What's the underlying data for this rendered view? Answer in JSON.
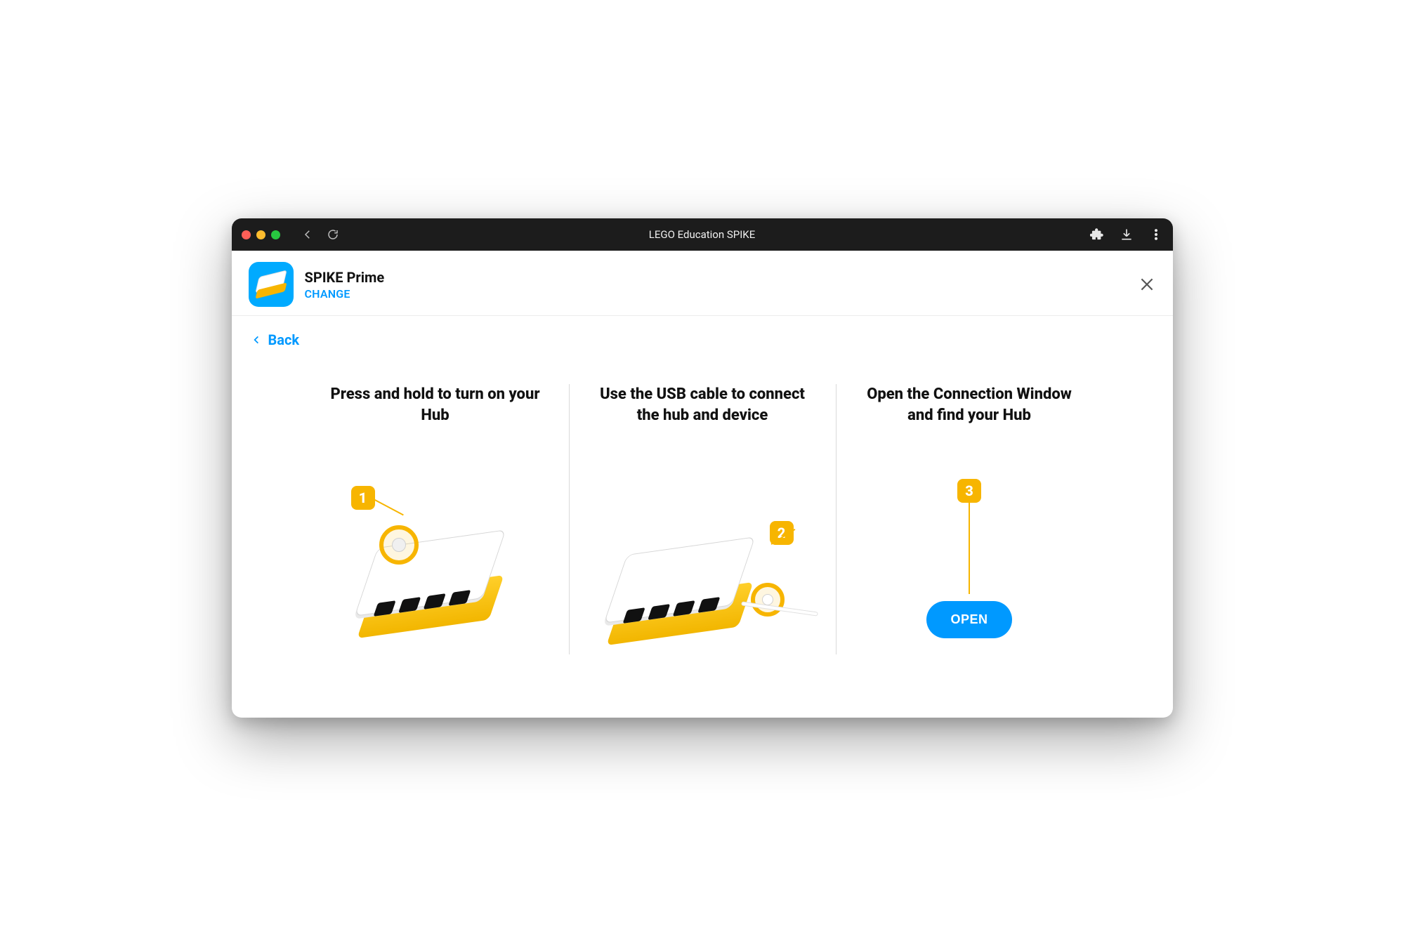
{
  "titlebar": {
    "title": "LEGO Education SPIKE"
  },
  "header": {
    "product_name": "SPIKE Prime",
    "change_label": "CHANGE"
  },
  "back": {
    "label": "Back"
  },
  "steps": {
    "s1": {
      "title": "Press and hold to turn on your Hub",
      "badge": "1"
    },
    "s2": {
      "title": "Use the USB cable to connect the hub and device",
      "badge": "2"
    },
    "s3": {
      "title": "Open the Connection Window and find your Hub",
      "badge": "3",
      "button": "OPEN"
    }
  },
  "colors": {
    "accent_blue": "#0099ff",
    "accent_yellow": "#f7b500"
  }
}
